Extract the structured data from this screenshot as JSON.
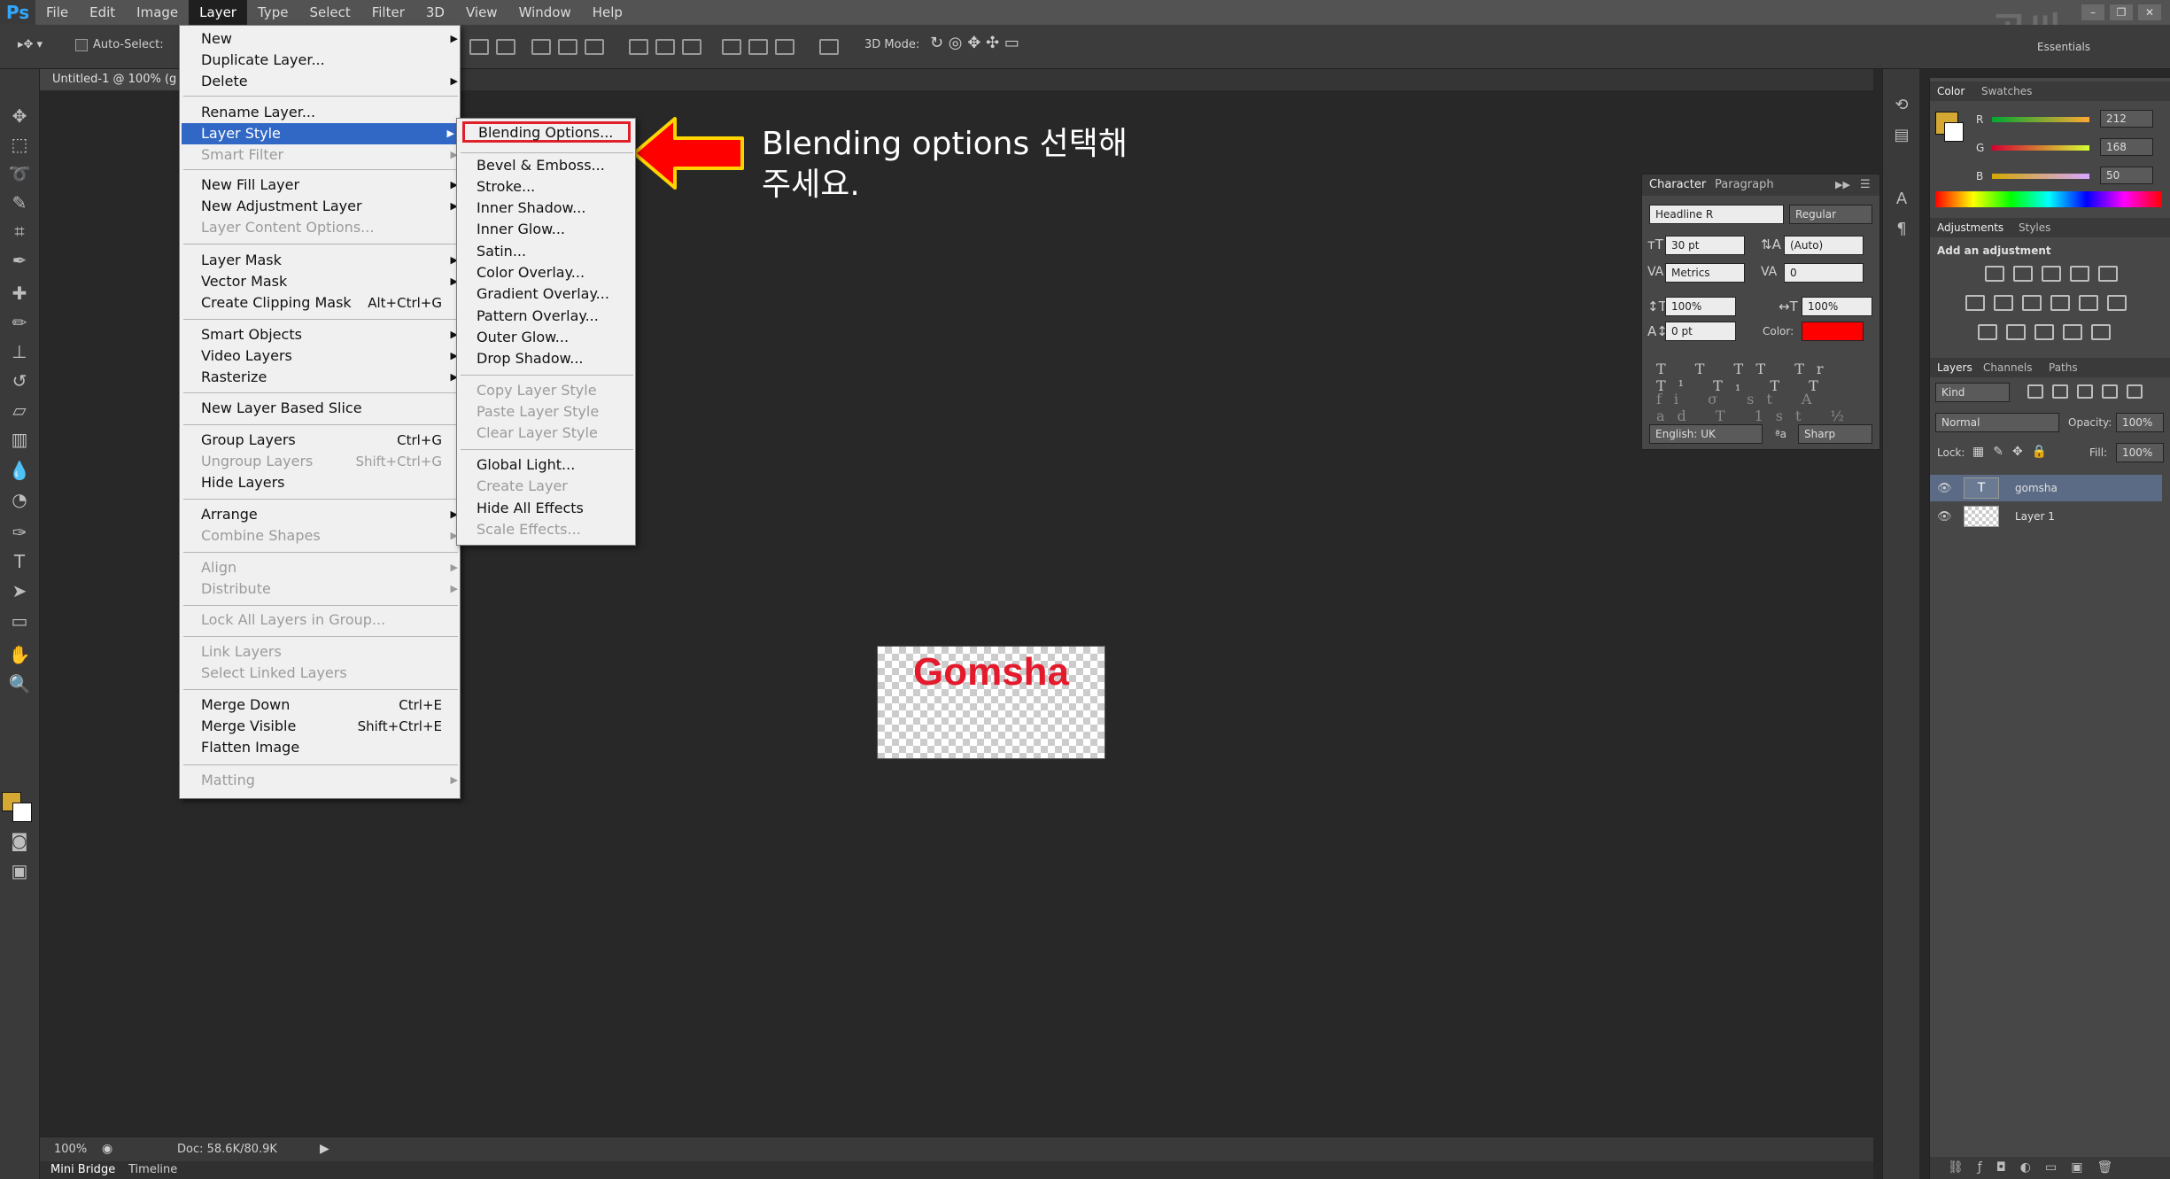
{
  "app": {
    "logo": "Ps"
  },
  "menubar": [
    "File",
    "Edit",
    "Image",
    "Layer",
    "Type",
    "Select",
    "Filter",
    "3D",
    "View",
    "Window",
    "Help"
  ],
  "window_controls": [
    "–",
    "❐",
    "✕"
  ],
  "watermark": {
    "text": "곰싸",
    "url": "goom-myang.tistory.com"
  },
  "options_bar": {
    "auto_select": "Auto-Select:",
    "mode_3d": "3D Mode:",
    "workspace": "Essentials"
  },
  "document": {
    "tab": "Untitled-1 @ 100% (g",
    "text": "Gomsha",
    "text_color": "#e41a2c"
  },
  "annotation": {
    "line1": "Blending options 선택해",
    "line2": "주세요."
  },
  "status": {
    "zoom": "100%",
    "doc": "Doc: 58.6K/80.9K"
  },
  "bottom_tabs": [
    "Mini Bridge",
    "Timeline"
  ],
  "layer_menu": {
    "items": [
      {
        "label": "New",
        "arrow": "▶",
        "shortcut": ""
      },
      {
        "label": "Duplicate Layer...",
        "arrow": "",
        "shortcut": ""
      },
      {
        "label": "Delete",
        "arrow": "▶",
        "shortcut": ""
      },
      {
        "label": "Rename Layer...",
        "arrow": "",
        "shortcut": ""
      },
      {
        "label": "Layer Style",
        "arrow": "▶",
        "shortcut": ""
      },
      {
        "label": "Smart Filter",
        "arrow": "▶",
        "shortcut": ""
      },
      {
        "label": "New Fill Layer",
        "arrow": "▶",
        "shortcut": ""
      },
      {
        "label": "New Adjustment Layer",
        "arrow": "▶",
        "shortcut": ""
      },
      {
        "label": "Layer Content Options...",
        "arrow": "",
        "shortcut": ""
      },
      {
        "label": "Layer Mask",
        "arrow": "▶",
        "shortcut": ""
      },
      {
        "label": "Vector Mask",
        "arrow": "▶",
        "shortcut": ""
      },
      {
        "label": "Create Clipping Mask",
        "arrow": "",
        "shortcut": "Alt+Ctrl+G"
      },
      {
        "label": "Smart Objects",
        "arrow": "▶",
        "shortcut": ""
      },
      {
        "label": "Video Layers",
        "arrow": "▶",
        "shortcut": ""
      },
      {
        "label": "Rasterize",
        "arrow": "▶",
        "shortcut": ""
      },
      {
        "label": "New Layer Based Slice",
        "arrow": "",
        "shortcut": ""
      },
      {
        "label": "Group Layers",
        "arrow": "",
        "shortcut": "Ctrl+G"
      },
      {
        "label": "Ungroup Layers",
        "arrow": "",
        "shortcut": "Shift+Ctrl+G"
      },
      {
        "label": "Hide Layers",
        "arrow": "",
        "shortcut": ""
      },
      {
        "label": "Arrange",
        "arrow": "▶",
        "shortcut": ""
      },
      {
        "label": "Combine Shapes",
        "arrow": "▶",
        "shortcut": ""
      },
      {
        "label": "Align",
        "arrow": "▶",
        "shortcut": ""
      },
      {
        "label": "Distribute",
        "arrow": "▶",
        "shortcut": ""
      },
      {
        "label": "Lock All Layers in Group...",
        "arrow": "",
        "shortcut": ""
      },
      {
        "label": "Link Layers",
        "arrow": "",
        "shortcut": ""
      },
      {
        "label": "Select Linked Layers",
        "arrow": "",
        "shortcut": ""
      },
      {
        "label": "Merge Down",
        "arrow": "",
        "shortcut": "Ctrl+E"
      },
      {
        "label": "Merge Visible",
        "arrow": "",
        "shortcut": "Shift+Ctrl+E"
      },
      {
        "label": "Flatten Image",
        "arrow": "",
        "shortcut": ""
      },
      {
        "label": "Matting",
        "arrow": "▶",
        "shortcut": ""
      }
    ]
  },
  "style_menu": {
    "items": [
      "Blending Options...",
      "Bevel & Emboss...",
      "Stroke...",
      "Inner Shadow...",
      "Inner Glow...",
      "Satin...",
      "Color Overlay...",
      "Gradient Overlay...",
      "Pattern Overlay...",
      "Outer Glow...",
      "Drop Shadow...",
      "Copy Layer Style",
      "Paste Layer Style",
      "Clear Layer Style",
      "Global Light...",
      "Create Layer",
      "Hide All Effects",
      "Scale Effects..."
    ]
  },
  "character": {
    "tabs": [
      "Character",
      "Paragraph"
    ],
    "font": "Headline R",
    "style": "Regular",
    "size": "30 pt",
    "leading": "(Auto)",
    "kerning": "Metrics",
    "tracking": "0",
    "vscale": "100%",
    "hscale": "100%",
    "baseline": "0 pt",
    "color_label": "Color:",
    "color": "#ff0000",
    "type_glyphs": "T T TT Tr T¹ T₁ T T",
    "ot_glyphs": "fi σ st A ad T 1st ½",
    "language": "English: UK",
    "aa_label": "ªa",
    "antialias": "Sharp"
  },
  "color_panel": {
    "tabs": [
      "Color",
      "Swatches"
    ],
    "r_label": "R",
    "g_label": "G",
    "b_label": "B",
    "r": "212",
    "g": "168",
    "b": "50",
    "fg": "#d4a832"
  },
  "adjustments": {
    "tabs": [
      "Adjustments",
      "Styles"
    ],
    "title": "Add an adjustment"
  },
  "layers_panel": {
    "tabs": [
      "Layers",
      "Channels",
      "Paths"
    ],
    "filter": "Kind",
    "blend": "Normal",
    "opacity_label": "Opacity:",
    "opacity": "100%",
    "lock_label": "Lock:",
    "fill_label": "Fill:",
    "fill": "100%",
    "layers": [
      {
        "name": "gomsha",
        "type": "text"
      },
      {
        "name": "Layer 1",
        "type": "raster"
      }
    ]
  }
}
